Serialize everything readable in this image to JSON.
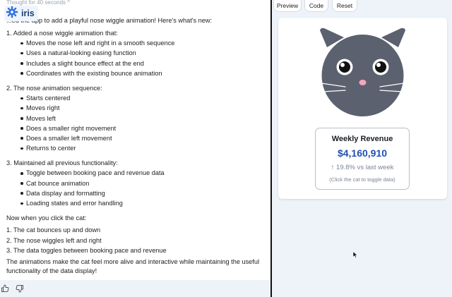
{
  "chat": {
    "thought": "Thought for 40 seconds ^",
    "brand": "iris",
    "intro": "...ed the app to add a playful nose wiggle animation! Here's what's new:",
    "sections": [
      {
        "heading": "1. Added a nose wiggle animation that:",
        "bullets": [
          "Moves the nose left and right in a smooth sequence",
          "Uses a natural-looking easing function",
          "Includes a slight bounce effect at the end",
          "Coordinates with the existing bounce animation"
        ]
      },
      {
        "heading": "2. The nose animation sequence:",
        "bullets": [
          "Starts centered",
          "Moves right",
          "Moves left",
          "Does a smaller right movement",
          "Does a smaller left movement",
          "Returns to center"
        ]
      },
      {
        "heading": "3. Maintained all previous functionality:",
        "bullets": [
          "Toggle between booking pace and revenue data",
          "Cat bounce animation",
          "Data display and formatting",
          "Loading states and error handling"
        ]
      }
    ],
    "click_intro": "Now when you click the cat:",
    "click_steps": [
      "1. The cat bounces up and down",
      "2. The nose wiggles left and right",
      "3. The data toggles between booking pace and revenue"
    ],
    "closing_line1": "The animations make the cat feel more alive and interactive while maintaining the useful",
    "closing_line2": "functionality of the data display!",
    "footer_icons": [
      "thumbs-up-icon",
      "thumbs-down-icon"
    ]
  },
  "preview": {
    "tabs": [
      "Preview",
      "Code",
      "Reset"
    ],
    "revenue": {
      "title": "Weekly Revenue",
      "value": "$4,160,910",
      "change": "↑ 19.8% vs last week",
      "hint": "(Click the cat to toggle data)"
    }
  },
  "colors": {
    "accent": "#1f50b5",
    "cat_body": "#5c6170",
    "nose": "#f4a7b9",
    "brand": "#1b3f78"
  }
}
